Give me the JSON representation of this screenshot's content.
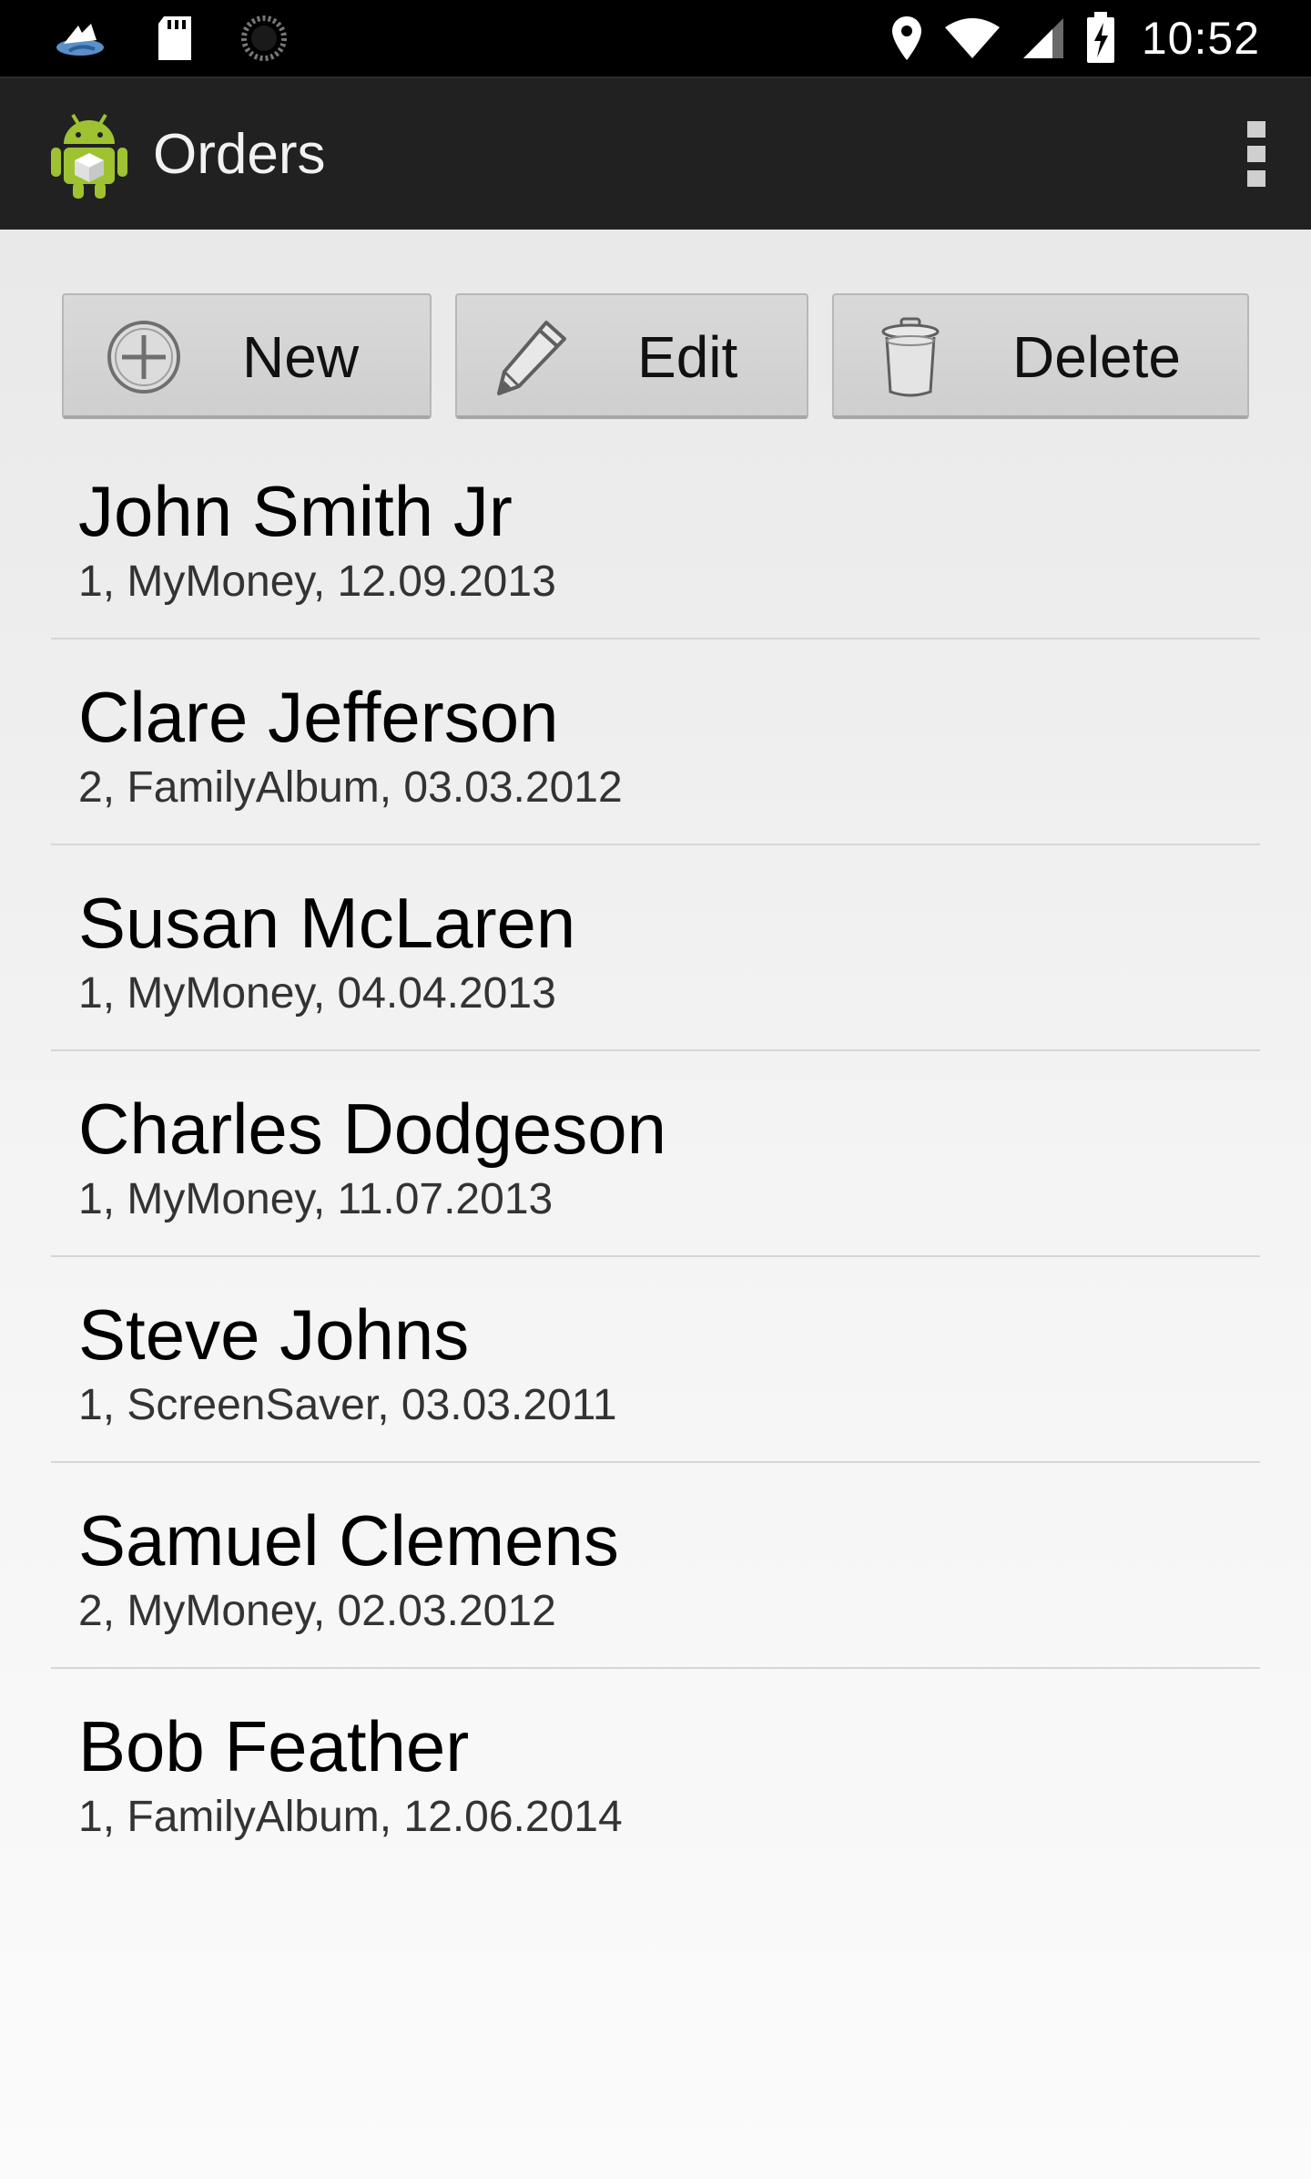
{
  "status_bar": {
    "time": "10:52",
    "left_icons": [
      "sync-icon",
      "sd-card-icon",
      "loading-spinner-icon"
    ],
    "right_icons": [
      "location-icon",
      "wifi-icon",
      "signal-icon",
      "battery-charging-icon"
    ]
  },
  "action_bar": {
    "title": "Orders",
    "logo_icon": "android-app-icon",
    "overflow_icon": "overflow-menu-icon"
  },
  "toolbar": {
    "new_label": "New",
    "edit_label": "Edit",
    "delete_label": "Delete",
    "new_icon": "plus-circle-icon",
    "edit_icon": "pencil-icon",
    "delete_icon": "trash-icon"
  },
  "orders": [
    {
      "name": "John Smith Jr",
      "detail": "1, MyMoney, 12.09.2013"
    },
    {
      "name": "Clare Jefferson",
      "detail": "2, FamilyAlbum, 03.03.2012"
    },
    {
      "name": "Susan McLaren",
      "detail": "1, MyMoney, 04.04.2013"
    },
    {
      "name": "Charles Dodgeson",
      "detail": "1, MyMoney, 11.07.2013"
    },
    {
      "name": "Steve Johns",
      "detail": "1, ScreenSaver, 03.03.2011"
    },
    {
      "name": "Samuel Clemens",
      "detail": "2, MyMoney, 02.03.2012"
    },
    {
      "name": "Bob Feather",
      "detail": "1, FamilyAlbum, 12.06.2014"
    }
  ],
  "colors": {
    "status_bar": "#000000",
    "action_bar": "#212121",
    "button_face": "#d4d4d4",
    "divider": "#d6d6d6",
    "android_green": "#9fc232"
  }
}
